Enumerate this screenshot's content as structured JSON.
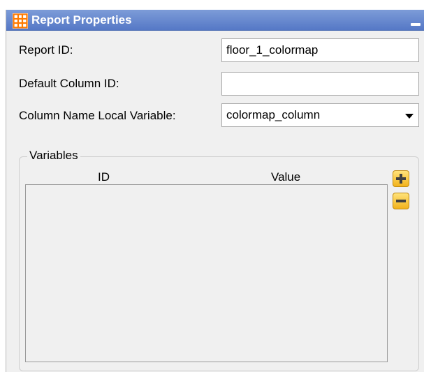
{
  "window": {
    "title": "Report Properties",
    "icon": "grid-icon",
    "minimize_icon": "minimize-icon"
  },
  "form": {
    "report_id_label": "Report ID:",
    "report_id_value": "floor_1_colormap",
    "default_column_id_label": "Default Column ID:",
    "default_column_id_value": "",
    "column_name_var_label": "Column Name Local Variable:",
    "column_name_var_value": "colormap_column"
  },
  "variables": {
    "group_title": "Variables",
    "columns": [
      "ID",
      "Value"
    ],
    "rows": [],
    "add_icon": "plus-icon",
    "remove_icon": "minus-icon"
  },
  "colors": {
    "title_bar": "#5f80cc",
    "title_icon": "#ff7a00",
    "button_fill": "#f5c033"
  }
}
